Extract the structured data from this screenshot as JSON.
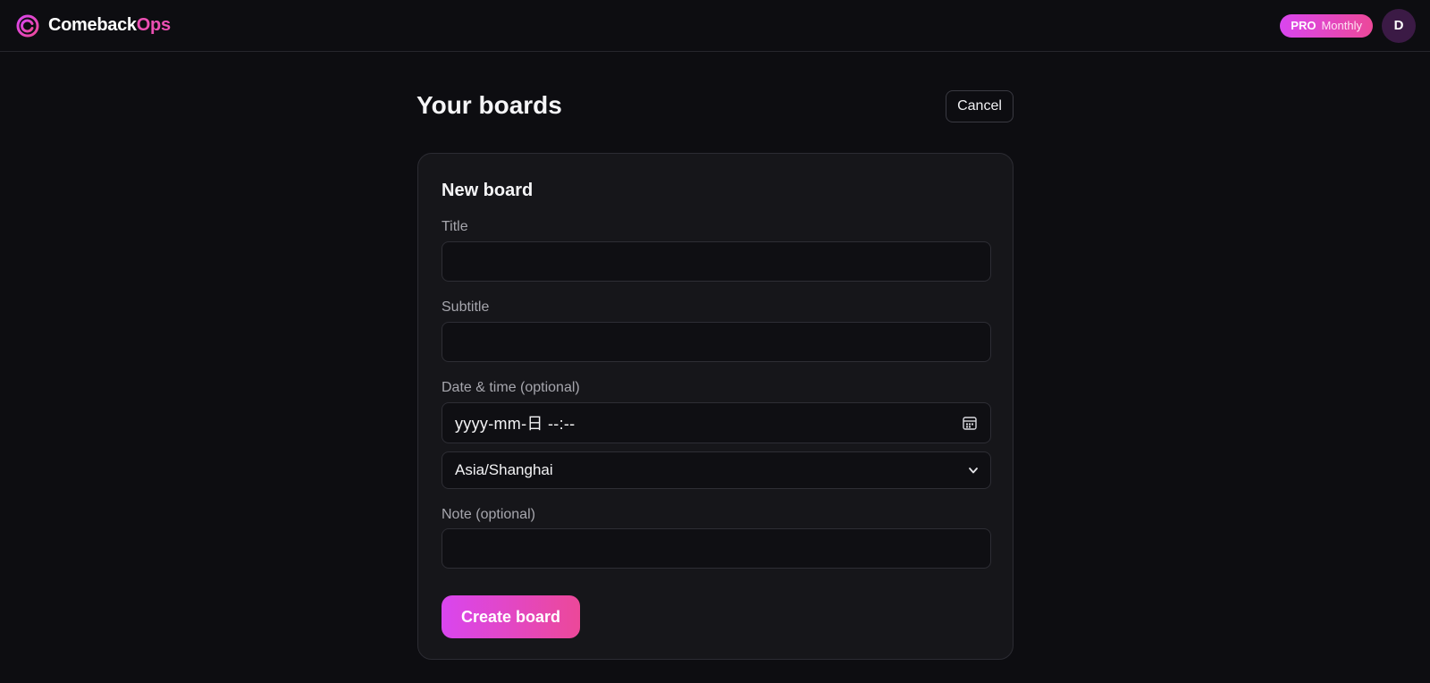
{
  "app": {
    "brand_part1": "Comeback",
    "brand_part2": "Ops",
    "logo_icon": "ring-logo-icon",
    "accent_gradient": [
      "#d946ef",
      "#ec4899"
    ]
  },
  "header": {
    "plan_badge": {
      "tier": "PRO",
      "cycle": "Monthly"
    },
    "avatar_initial": "D"
  },
  "page": {
    "title": "Your boards",
    "cancel_label": "Cancel"
  },
  "form": {
    "heading": "New board",
    "title_label": "Title",
    "title_value": "",
    "subtitle_label": "Subtitle",
    "subtitle_value": "",
    "datetime_label": "Date & time (optional)",
    "datetime_display": "yyyy-mm-日 --:--",
    "calendar_icon": "calendar-icon",
    "timezone_selected": "Asia/Shanghai",
    "timezone_icon": "chevron-down-icon",
    "note_label": "Note (optional)",
    "note_value": "",
    "submit_label": "Create board"
  }
}
